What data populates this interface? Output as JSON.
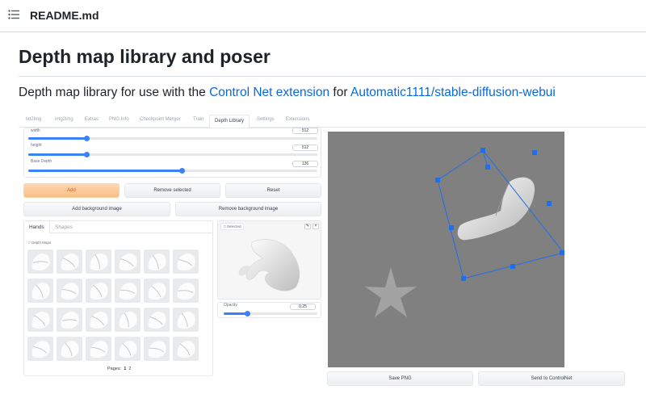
{
  "readme": {
    "title": "README.md"
  },
  "heading": "Depth map library and poser",
  "intro": {
    "prefix": "Depth map library for use with the ",
    "link1": "Control Net extension",
    "middle": " for ",
    "link2": "Automatic1111/stable-diffusion-webui"
  },
  "app": {
    "tabs": [
      "txt2img",
      "img2img",
      "Extras",
      "PNG Info",
      "Checkpoint Merger",
      "Train",
      "Depth Library",
      "Settings",
      "Extensions"
    ],
    "active_tab": "Depth Library",
    "sliders": [
      {
        "label": "width",
        "value": "512",
        "fraction": 0.2
      },
      {
        "label": "height",
        "value": "512",
        "fraction": 0.2
      },
      {
        "label": "Base Depth",
        "value": "136",
        "fraction": 0.53
      }
    ],
    "buttons": {
      "add": "Add",
      "remove_selected": "Remove selected",
      "reset": "Reset",
      "add_bg": "Add background image",
      "remove_bg": "Remove background image",
      "save_png": "Save PNG",
      "send_controlnet": "Send to ControlNet"
    },
    "library": {
      "tabs": [
        "Hands",
        "Shapes"
      ],
      "active_tab": "Hands",
      "section_label": "Depth Maps",
      "pages_label": "Pages:",
      "pages": [
        "1",
        "2"
      ]
    },
    "preview": {
      "label": "Selected"
    },
    "opacity": {
      "label": "Opacity",
      "value": "0.25",
      "fraction": 0.25
    },
    "colors": {
      "accent": "#3b82f6",
      "primary_text": "#ea580c",
      "canvas": "#808080"
    }
  }
}
